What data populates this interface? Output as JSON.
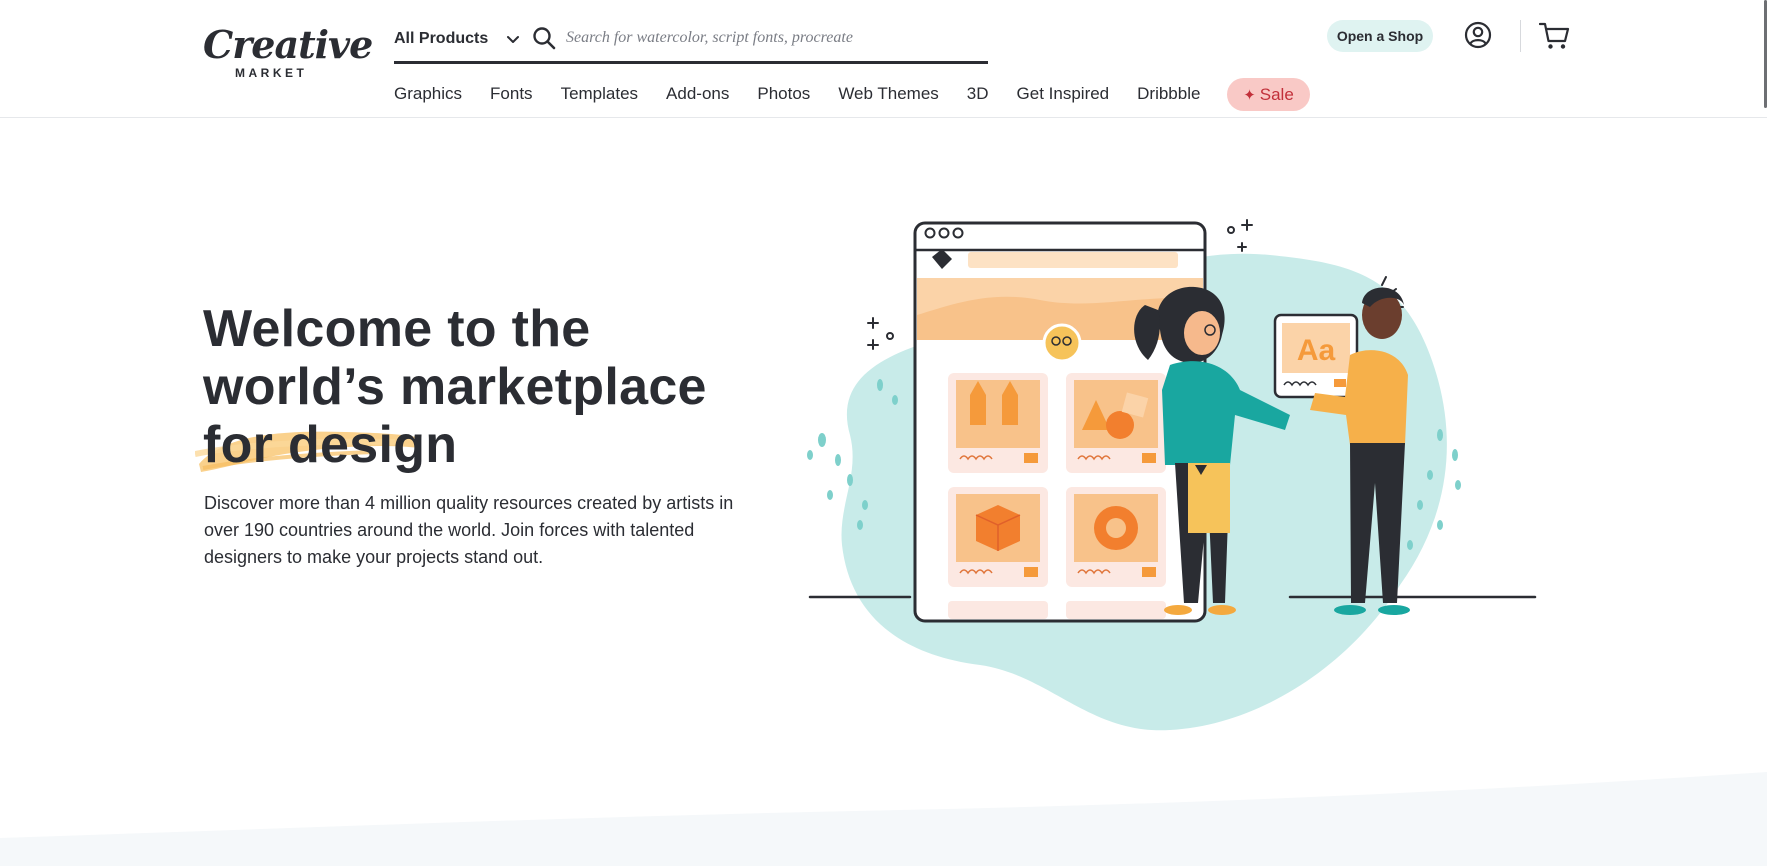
{
  "logo": {
    "main": "Creative",
    "sub": "MARKET"
  },
  "search": {
    "category": "All Products",
    "placeholder": "Search for watercolor, script fonts, procreate",
    "value": ""
  },
  "header": {
    "open_shop": "Open a Shop",
    "icons": {
      "account": "user-circle-icon",
      "cart": "cart-icon",
      "search": "search-icon",
      "chevron": "chevron-down-icon"
    }
  },
  "nav": {
    "items": [
      "Graphics",
      "Fonts",
      "Templates",
      "Add-ons",
      "Photos",
      "Web Themes",
      "3D",
      "Get Inspired",
      "Dribbble"
    ],
    "sale": "Sale",
    "sale_icon": "✦"
  },
  "hero": {
    "title_line1": "Welcome to the",
    "title_line2": "world’s marketplace",
    "title_line3": "for design",
    "text": "Discover more than 4 million quality resources created by artists in over 190 countries around the world. Join forces with talented designers to make your projects stand out."
  },
  "colors": {
    "text": "#2b2d33",
    "accent_teal": "#19a7a0",
    "blob_teal": "#c8ebe9",
    "orange": "#f4a93e",
    "sale_bg": "#f9c9c6",
    "sale_text": "#c2303a",
    "shop_bg": "#dff3f1",
    "band": "#f5f8fa"
  }
}
